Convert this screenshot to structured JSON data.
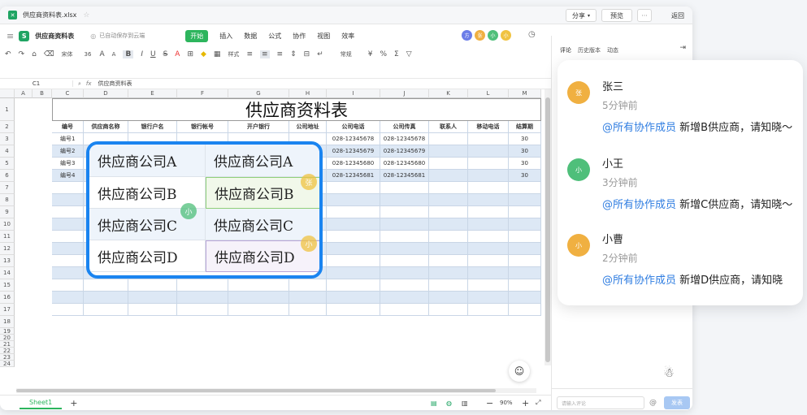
{
  "window": {
    "file_name": "供应商资料表.xlsx",
    "share_label": "分享",
    "preview_label": "预览",
    "more_label": "···",
    "back_label": "返回"
  },
  "doc": {
    "title": "供应商资料表",
    "autosave": "已自动保存到云端",
    "menus": [
      "开始",
      "插入",
      "数据",
      "公式",
      "协作",
      "视图",
      "效率"
    ],
    "collaborators": [
      "方",
      "张",
      "小",
      "小"
    ]
  },
  "toolbar": {
    "font_name": "宋体",
    "font_size": "36",
    "style_label": "样式",
    "format_label": "常规"
  },
  "formula": {
    "cell_ref": "C1",
    "content": "供应商资料表"
  },
  "sheet": {
    "col_letters": [
      "A",
      "B",
      "C",
      "D",
      "E",
      "F",
      "G",
      "H",
      "I",
      "J",
      "K",
      "L",
      "M"
    ],
    "row_numbers": [
      "1",
      "2",
      "3",
      "4",
      "5",
      "6",
      "7",
      "8",
      "9",
      "10",
      "11",
      "12",
      "13",
      "14",
      "15",
      "16",
      "17",
      "18",
      "19",
      "20",
      "21",
      "22",
      "23",
      "24"
    ],
    "title": "供应商资料表",
    "headers": [
      "编号",
      "供应商名称",
      "银行户名",
      "银行帐号",
      "开户银行",
      "公司地址",
      "公司电话",
      "公司传真",
      "联系人",
      "移动电话",
      "结算期"
    ],
    "rows": [
      {
        "id": "编号1",
        "phone": "028-12345678",
        "fax": "028-12345678",
        "term": "30"
      },
      {
        "id": "编号2",
        "phone": "028-12345679",
        "fax": "028-12345679",
        "term": "30"
      },
      {
        "id": "编号3",
        "phone": "028-12345680",
        "fax": "028-12345680",
        "term": "30"
      },
      {
        "id": "编号4",
        "phone": "028-12345681",
        "fax": "028-12345681",
        "term": "30"
      }
    ],
    "tab": "Sheet1",
    "add_tab": "+",
    "zoom": "90%"
  },
  "overlay": {
    "cells": [
      "供应商公司A",
      "供应商公司A",
      "供应商公司B",
      "供应商公司B",
      "供应商公司C",
      "供应商公司C",
      "供应商公司D",
      "供应商公司D"
    ],
    "badges": [
      "张",
      "小",
      "小"
    ]
  },
  "side": {
    "tabs": [
      "评论",
      "历史版本",
      "动态"
    ],
    "input_placeholder": "请输入评论",
    "at_label": "@",
    "send_label": "发表"
  },
  "comments": [
    {
      "avatar": "张",
      "name": "张三",
      "time": "5分钟前",
      "mention": "@所有协作成员",
      "text": " 新增B供应商，请知晓～",
      "color": "#f0b041"
    },
    {
      "avatar": "小",
      "name": "小王",
      "time": "3分钟前",
      "mention": "@所有协作成员",
      "text": " 新增C供应商，请知晓～",
      "color": "#4fbf7a"
    },
    {
      "avatar": "小",
      "name": "小曹",
      "time": "2分钟前",
      "mention": "@所有协作成员",
      "text": " 新增D供应商，请知晓",
      "color": "#f0b041"
    }
  ]
}
